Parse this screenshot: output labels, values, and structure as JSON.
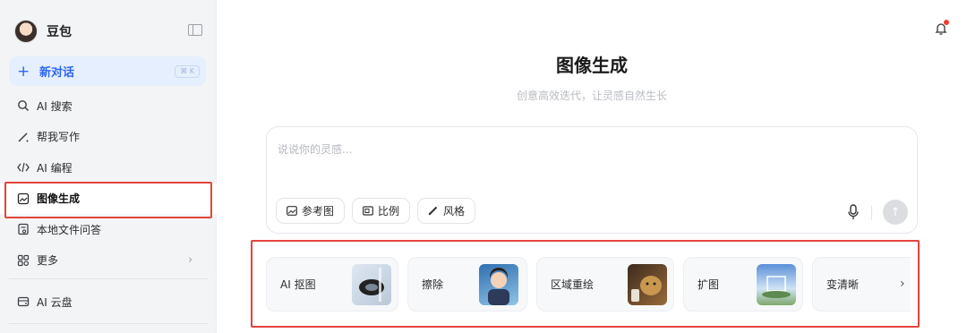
{
  "sidebar": {
    "brand_name": "豆包",
    "new_chat": {
      "label": "新对话",
      "shortcut": "⌘ K"
    },
    "items": [
      {
        "label": "AI 搜索",
        "icon": "search-icon"
      },
      {
        "label": "帮我写作",
        "icon": "pen-icon"
      },
      {
        "label": "AI 编程",
        "icon": "code-icon"
      },
      {
        "label": "图像生成",
        "icon": "image-icon",
        "active": true
      },
      {
        "label": "本地文件问答",
        "icon": "file-icon"
      },
      {
        "label": "更多",
        "icon": "apps-icon"
      }
    ],
    "cloud": {
      "label": "AI 云盘",
      "icon": "cloud-drive-icon"
    }
  },
  "main": {
    "title": "图像生成",
    "subtitle": "创意高效迭代，让灵感自然生长",
    "composer": {
      "placeholder": "说说你的灵感...",
      "chips": [
        {
          "label": "参考图",
          "icon": "reference-image-icon"
        },
        {
          "label": "比例",
          "icon": "aspect-ratio-icon"
        },
        {
          "label": "风格",
          "icon": "brush-icon"
        }
      ]
    },
    "tools": [
      {
        "label": "AI 抠图"
      },
      {
        "label": "擦除"
      },
      {
        "label": "区域重绘"
      },
      {
        "label": "扩图"
      },
      {
        "label": "变清晰"
      }
    ]
  },
  "colors": {
    "accent": "#2c67f2",
    "highlight": "#e2453c",
    "notification": "#f43a2f"
  }
}
